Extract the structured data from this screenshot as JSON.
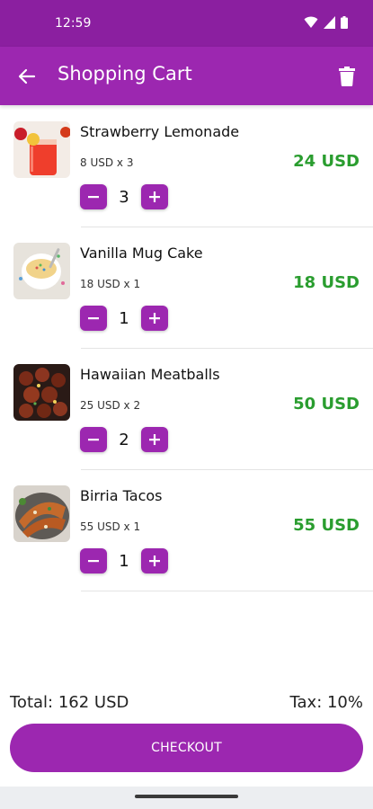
{
  "status": {
    "time": "12:59"
  },
  "header": {
    "title": "Shopping Cart"
  },
  "items": [
    {
      "name": "Strawberry Lemonade",
      "unit_line": "8 USD x 3",
      "total": "24 USD",
      "quantity": "3"
    },
    {
      "name": "Vanilla Mug Cake",
      "unit_line": "18 USD x 1",
      "total": "18 USD",
      "quantity": "1"
    },
    {
      "name": "Hawaiian Meatballs",
      "unit_line": "25 USD x 2",
      "total": "50 USD",
      "quantity": "2"
    },
    {
      "name": "Birria Tacos",
      "unit_line": "55 USD x 1",
      "total": "55 USD",
      "quantity": "1"
    }
  ],
  "summary": {
    "total": "Total: 162 USD",
    "tax": "Tax: 10%"
  },
  "checkout": {
    "label": "CHECKOUT"
  },
  "colors": {
    "primary": "#9c27b0",
    "status_bar": "#8b1fa0",
    "price": "#2a9d2f"
  }
}
